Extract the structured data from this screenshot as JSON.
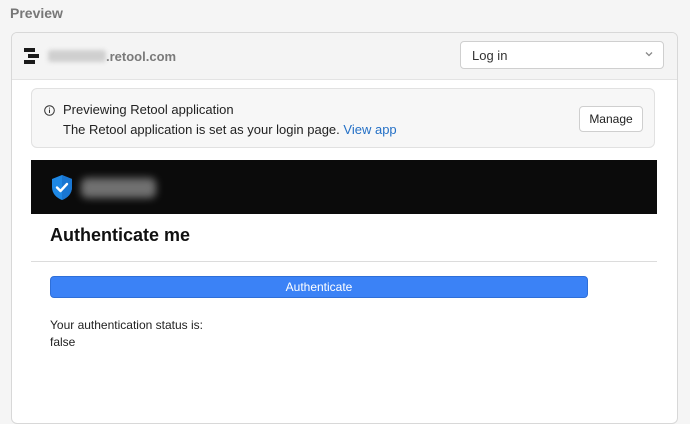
{
  "section": {
    "title": "Preview"
  },
  "topbar": {
    "domain_suffix": ".retool.com",
    "select": {
      "selected": "Log in"
    }
  },
  "banner": {
    "title": "Previewing Retool application",
    "desc": "The Retool application is set as your login page.",
    "link": "View app",
    "manage_label": "Manage"
  },
  "app": {
    "title": "Authenticate me",
    "button_label": "Authenticate",
    "status_label": "Your authentication status is:",
    "status_value": "false"
  },
  "colors": {
    "accent": "#3b82f6",
    "link": "#2470c6",
    "header_bg": "#0b0b0b",
    "shield": "#1e88e5"
  },
  "icons": {
    "logo": "retool-logo-icon",
    "chevron": "chevron-down-icon",
    "info": "info-icon",
    "shield": "shield-check-icon"
  }
}
